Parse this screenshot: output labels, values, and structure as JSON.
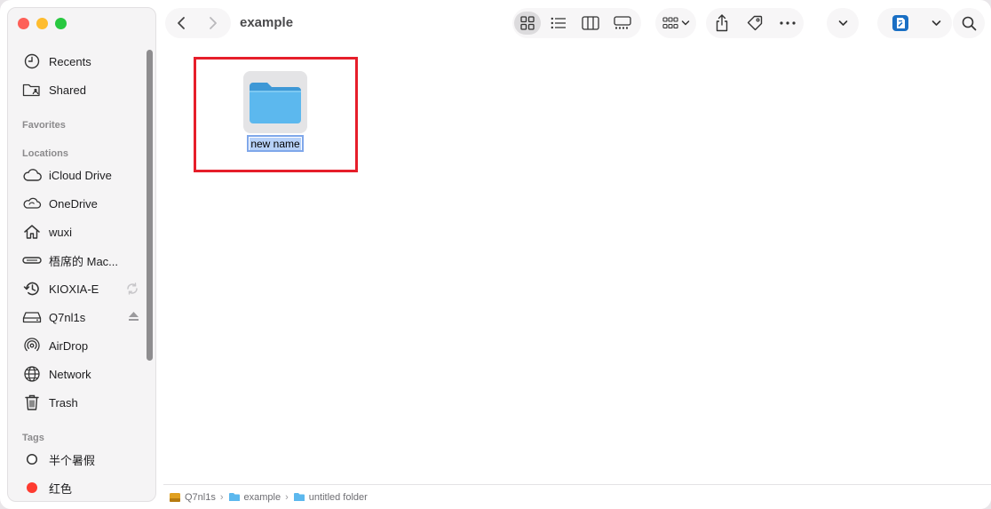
{
  "window": {
    "title": "example"
  },
  "sidebar": {
    "sections": {
      "favorites": "Favorites",
      "locations": "Locations",
      "tags": "Tags"
    },
    "top_items": [
      {
        "label": "Recents",
        "icon": "clock-icon"
      },
      {
        "label": "Shared",
        "icon": "shared-folder-icon"
      }
    ],
    "locations": [
      {
        "label": "iCloud Drive",
        "icon": "cloud-icon"
      },
      {
        "label": "OneDrive",
        "icon": "cloud-outline-icon"
      },
      {
        "label": "wuxi",
        "icon": "home-icon"
      },
      {
        "label": "梧席的 Mac...",
        "icon": "computer-icon"
      },
      {
        "label": "KIOXIA-E",
        "icon": "time-machine-icon"
      },
      {
        "label": "Q7nl1s",
        "icon": "drive-icon"
      },
      {
        "label": "AirDrop",
        "icon": "airdrop-icon"
      },
      {
        "label": "Network",
        "icon": "globe-icon"
      },
      {
        "label": "Trash",
        "icon": "trash-icon"
      }
    ],
    "tags": [
      {
        "label": "半个暑假",
        "color": "#ffffff"
      },
      {
        "label": "红色",
        "color": "#fe3b30"
      }
    ]
  },
  "toolbar": {
    "view_modes": [
      "icon-view-icon",
      "list-view-icon",
      "column-view-icon",
      "gallery-view-icon"
    ],
    "selected_view": "icon-view-icon"
  },
  "content": {
    "folder_name_editing": "new name"
  },
  "pathbar": {
    "crumbs": [
      "Q7nl1s",
      "example",
      "untitled folder"
    ],
    "separator": "›"
  },
  "colors": {
    "accent": "#5aaee8",
    "highlight": "#e61e2a"
  }
}
